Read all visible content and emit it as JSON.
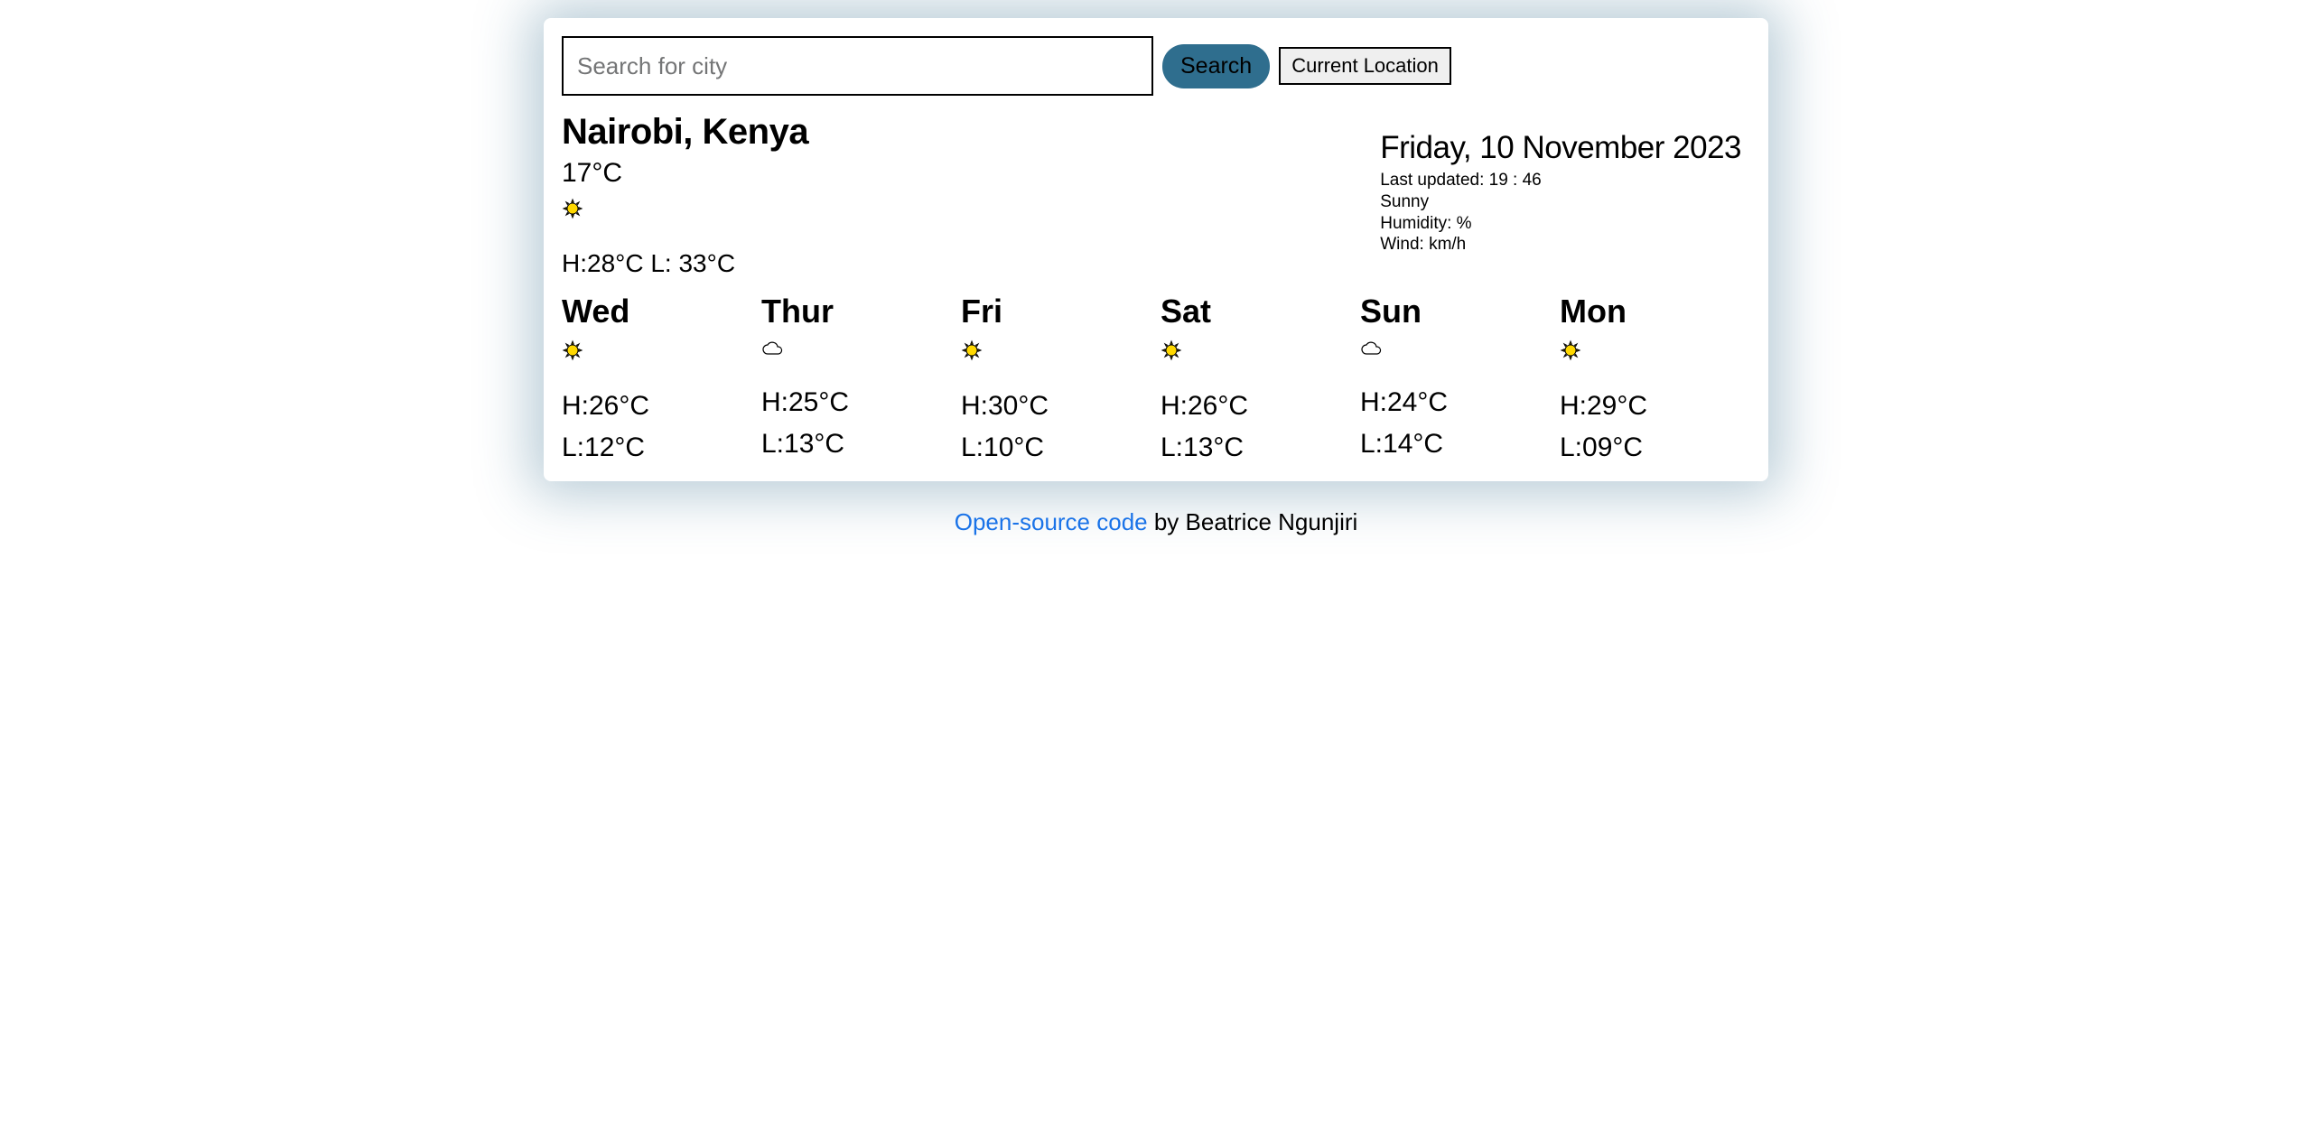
{
  "search": {
    "placeholder": "Search for city",
    "button_label": "Search",
    "location_button_label": "Current Location"
  },
  "current": {
    "location": "Nairobi, Kenya",
    "temp": "17°C",
    "high_low": "H:28°C L: 33°C"
  },
  "details": {
    "date": "Friday, 10 November 2023",
    "last_updated": "Last updated: 19 : 46",
    "condition": "Sunny",
    "humidity": "Humidity: %",
    "wind": "Wind: km/h"
  },
  "forecast": [
    {
      "day": "Wed",
      "icon": "sun",
      "high": "H:26°C",
      "low": "L:12°C"
    },
    {
      "day": "Thur",
      "icon": "cloud",
      "high": "H:25°C",
      "low": "L:13°C"
    },
    {
      "day": "Fri",
      "icon": "sun",
      "high": "H:30°C",
      "low": "L:10°C"
    },
    {
      "day": "Sat",
      "icon": "sun",
      "high": "H:26°C",
      "low": "L:13°C"
    },
    {
      "day": "Sun",
      "icon": "cloud",
      "high": "H:24°C",
      "low": "L:14°C"
    },
    {
      "day": "Mon",
      "icon": "sun",
      "high": "H:29°C",
      "low": "L:09°C"
    }
  ],
  "footer": {
    "link_text": "Open-source code",
    "by_text": " by Beatrice Ngunjiri"
  },
  "icons": {
    "sun": "sun-icon",
    "cloud": "cloud-icon"
  }
}
